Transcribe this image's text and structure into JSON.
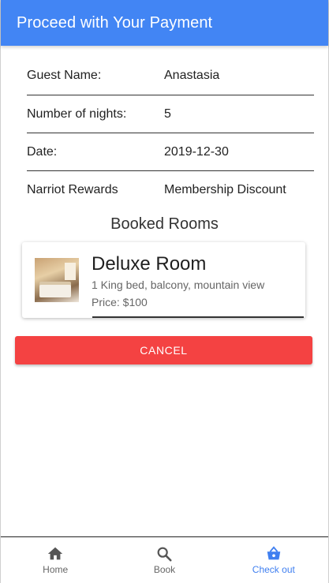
{
  "header": {
    "title": "Proceed with Your Payment"
  },
  "details": [
    {
      "label": "Guest Name:",
      "value": "Anastasia"
    },
    {
      "label": "Number of nights:",
      "value": "5"
    },
    {
      "label": "Date:",
      "value": "2019-12-30"
    },
    {
      "label": "Narriot Rewards",
      "value": "Membership Discount"
    }
  ],
  "booked": {
    "section_title": "Booked Rooms",
    "room": {
      "name": "Deluxe Room",
      "description": "1 King bed, balcony, mountain view",
      "price": "Price: $100",
      "image_icon": "room-photo"
    }
  },
  "actions": {
    "cancel_label": "CANCEL"
  },
  "nav": {
    "items": [
      {
        "label": "Home",
        "icon": "home-icon"
      },
      {
        "label": "Book",
        "icon": "search-icon"
      },
      {
        "label": "Check out",
        "icon": "basket-icon"
      }
    ],
    "active_index": 2
  },
  "colors": {
    "appbar": "#4285f4",
    "cancel": "#f44242",
    "nav_active": "#3f7ff0"
  }
}
